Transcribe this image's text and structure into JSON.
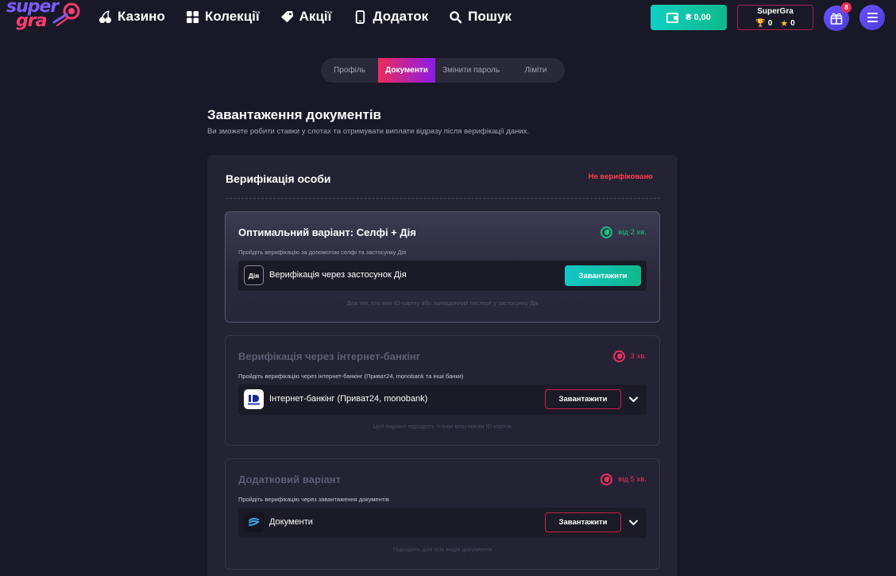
{
  "logo": {
    "line1": "super",
    "line2": "gra"
  },
  "nav": {
    "casino": "Казино",
    "collections": "Колекції",
    "promotions": "Акції",
    "app": "Додаток",
    "search": "Пошук"
  },
  "wallet": {
    "balance": "₴ 0,00"
  },
  "user": {
    "name": "SuperGra",
    "trophies": "0",
    "stars": "0"
  },
  "gifts": {
    "count": "8"
  },
  "tabs": {
    "profile": "Профіль",
    "documents": "Документи",
    "change_password": "Змінити пароль",
    "limits": "Ліміти"
  },
  "page": {
    "title": "Завантаження документів",
    "subtitle": "Ви зможете робити ставки у слотах та отримувати виплати відразу після верифікації даних."
  },
  "verification": {
    "title": "Верифікація особи",
    "status": "Не верифіковано",
    "options": [
      {
        "title": "Оптимальний варіант: Селфі + Дія",
        "time": "від 2 хв.",
        "description": "Пройдіть верифікацію за допомогою селфі та застосунку Дія",
        "method_icon_text": "Дія",
        "method_label": "Верифікація через застосунок Дія",
        "button": "Завантажити",
        "note": "Для тих, хто має ID-картку або закордонний паспорт у застосунку Дія"
      },
      {
        "title": "Верифікація через інтернет-банкінг",
        "time": "3 хв.",
        "description": "Пройдіть верифікацію через інтернет-банкінг (Приват24, monobank та інші банки)",
        "method_label": "Інтернет-банкінг (Приват24, monobank)",
        "button": "Завантажити",
        "note": "Цей варіант підходить тільки власникам ID-карток"
      },
      {
        "title": "Додатковий варіант",
        "time": "від 5 хв.",
        "description": "Пройдіть верифікацію через завантаження документів",
        "method_label": "Документи",
        "button": "Завантажити",
        "note": "Підходить для усіх видів документів"
      }
    ]
  }
}
